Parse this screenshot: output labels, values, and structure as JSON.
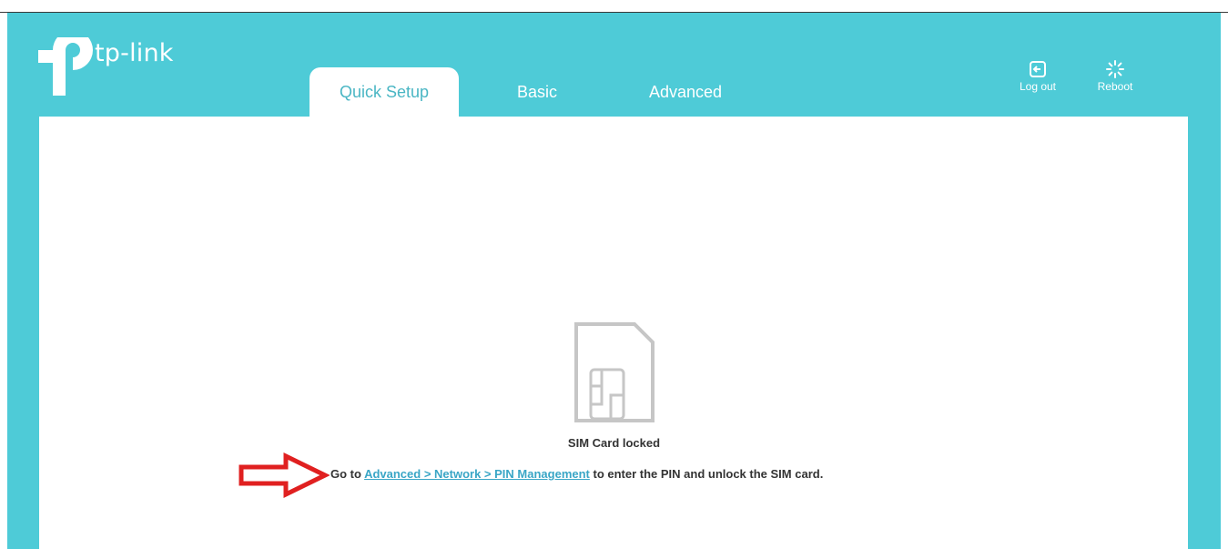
{
  "brand": {
    "logo_text": "tp-link"
  },
  "tabs": [
    {
      "label": "Quick Setup",
      "active": true
    },
    {
      "label": "Basic",
      "active": false
    },
    {
      "label": "Advanced",
      "active": false
    }
  ],
  "header_buttons": {
    "logout_label": "Log out",
    "reboot_label": "Reboot"
  },
  "sim": {
    "status": "SIM Card locked",
    "instruction_prefix": "Go to ",
    "link_text": "Advanced > Network > PIN Management",
    "instruction_suffix": " to enter the PIN and unlock the SIM card."
  },
  "colors": {
    "header_bg": "#4ecbd7",
    "active_tab_text": "#4ab6c4",
    "link": "#3aa6c6",
    "arrow": "#e02020"
  },
  "icons": [
    "tp-link-logo-icon",
    "logout-icon",
    "reboot-icon",
    "sim-card-icon",
    "red-arrow-icon"
  ]
}
